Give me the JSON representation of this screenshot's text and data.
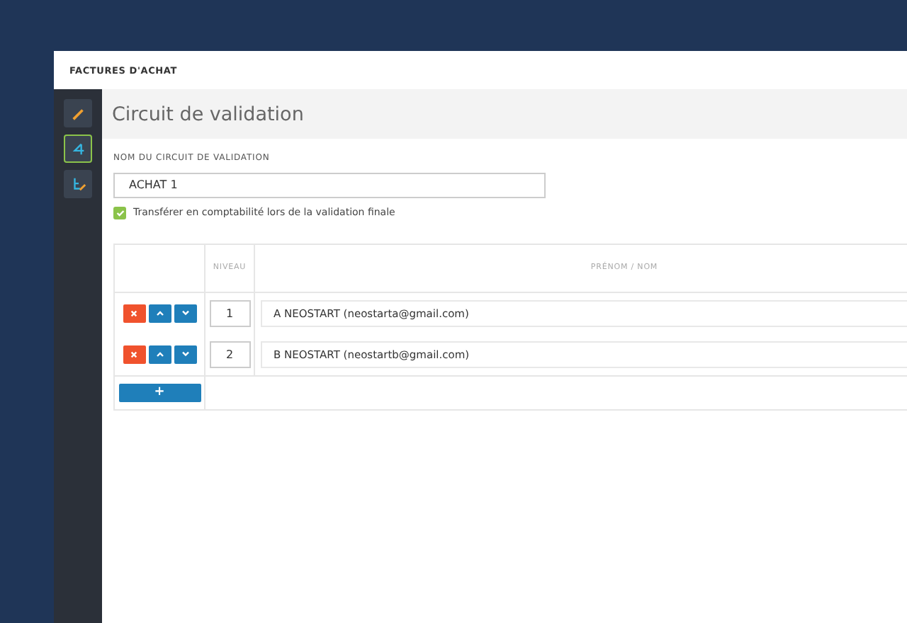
{
  "window": {
    "title": "FACTURES D'ACHAT"
  },
  "sidebar": {
    "items": [
      {
        "kind": "pencil",
        "selected": false
      },
      {
        "kind": "flow",
        "selected": true
      },
      {
        "kind": "tree",
        "selected": false
      }
    ]
  },
  "page": {
    "title": "Circuit de validation"
  },
  "form": {
    "name_label": "NOM DU CIRCUIT DE VALIDATION",
    "name_value": "ACHAT 1",
    "transfer": {
      "label": "Transférer en comptabilité lors de la validation finale",
      "checked": true
    }
  },
  "table": {
    "columns": [
      "NIVEAU",
      "PRÉNOM / NOM"
    ],
    "rows": [
      {
        "level": "1",
        "name": "A NEOSTART (neostarta@gmail.com)"
      },
      {
        "level": "2",
        "name": "B NEOSTART (neostartb@gmail.com)"
      }
    ],
    "add_button": "+"
  }
}
